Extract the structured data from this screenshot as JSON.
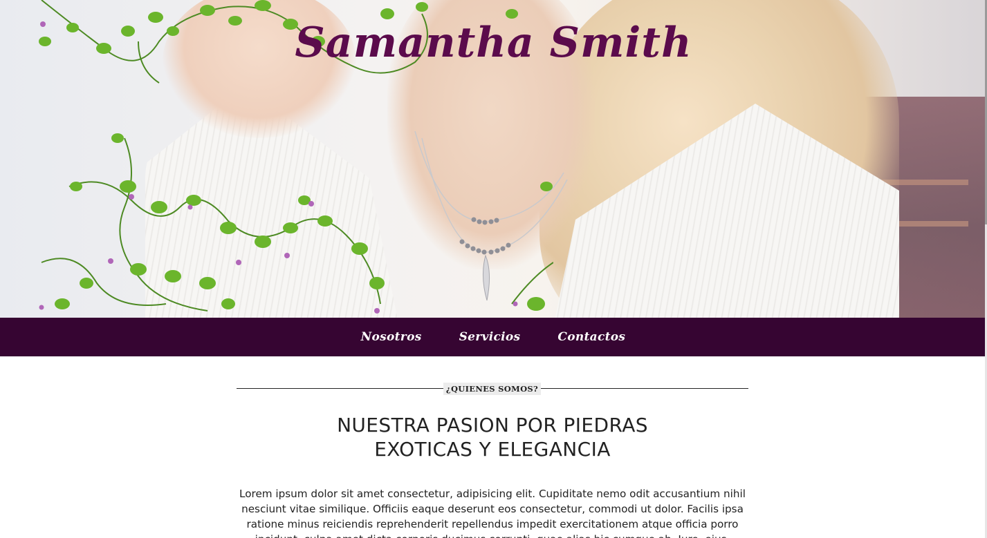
{
  "header": {
    "site_title": "Samantha Smith",
    "hero_image": "woman-with-necklace-and-vines-photo"
  },
  "nav": {
    "items": [
      {
        "label": "Nosotros"
      },
      {
        "label": "Servicios"
      },
      {
        "label": "Contactos"
      }
    ]
  },
  "about": {
    "tag": "¿QUIENES SOMOS?",
    "heading_line1": "NUESTRA PASION POR PIEDRAS",
    "heading_line2": "EXOTICAS Y ELEGANCIA",
    "body": "Lorem ipsum dolor sit amet consectetur, adipisicing elit. Cupiditate nemo odit accusantium nihil nesciunt vitae similique. Officiis eaque deserunt eos consectetur, commodi ut dolor. Facilis ipsa ratione minus reiciendis reprehenderit repellendus impedit exercitationem atque officia porro incidunt, culpa amet dicta corporis ducimus corrupti, quae alias hic cumque ab. Iure, eius."
  },
  "colors": {
    "brand_purple": "#360532",
    "title_purple": "#5b0b4c",
    "text": "#222222",
    "tag_bg": "#ececec"
  }
}
